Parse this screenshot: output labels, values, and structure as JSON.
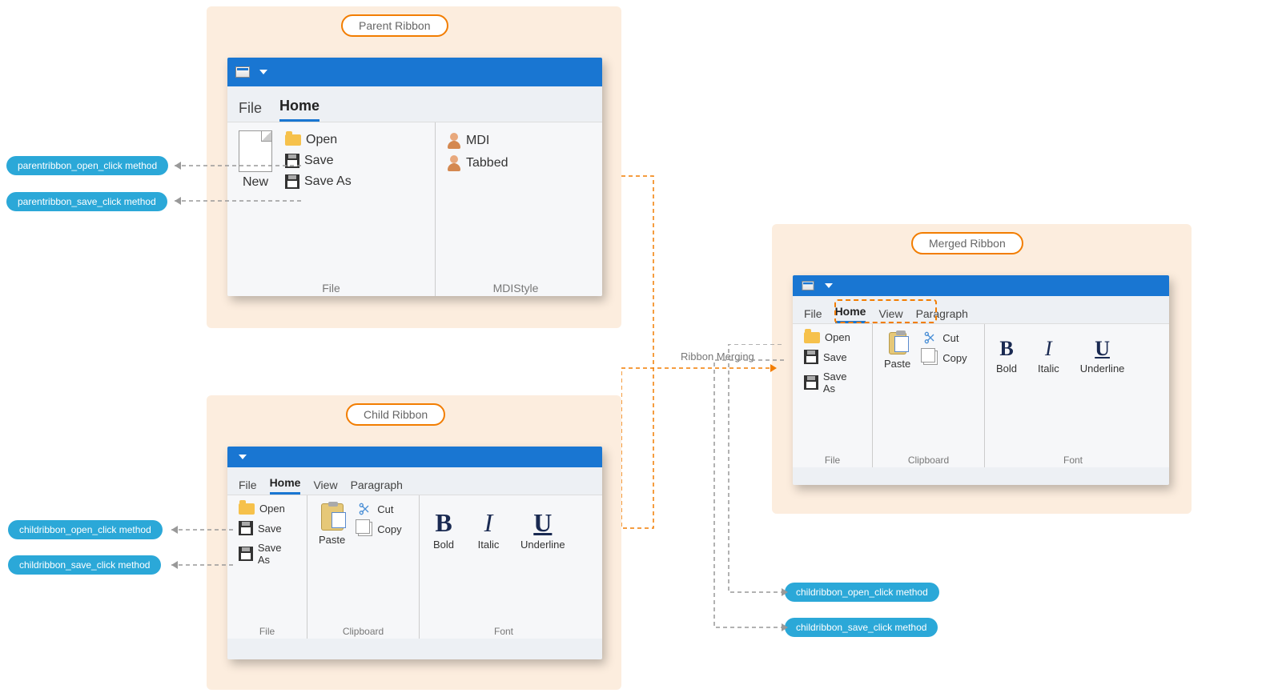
{
  "titles": {
    "parent": "Parent Ribbon",
    "child": "Child Ribbon",
    "merged": "Merged Ribbon"
  },
  "merge_label": "Ribbon Merging",
  "methods": {
    "parent_open": "parentribbon_open_click method",
    "parent_save": "parentribbon_save_click method",
    "child_open": "childribbon_open_click method",
    "child_save": "childribbon_save_click method",
    "merged_open": "childribbon_open_click method",
    "merged_save": "childribbon_save_click method"
  },
  "parent": {
    "tabs": {
      "file": "File",
      "home": "Home"
    },
    "buttons": {
      "new": "New",
      "open": "Open",
      "save": "Save",
      "saveas": "Save As",
      "mdi": "MDI",
      "tabbed": "Tabbed"
    },
    "groups": {
      "file": "File",
      "mdistyle": "MDIStyle"
    }
  },
  "child": {
    "tabs": {
      "file": "File",
      "home": "Home",
      "view": "View",
      "paragraph": "Paragraph"
    },
    "buttons": {
      "open": "Open",
      "save": "Save",
      "saveas": "Save As",
      "paste": "Paste",
      "cut": "Cut",
      "copy": "Copy",
      "bold": "Bold",
      "italic": "Italic",
      "underline": "Underline"
    },
    "groups": {
      "file": "File",
      "clipboard": "Clipboard",
      "font": "Font"
    },
    "glyphs": {
      "bold": "B",
      "italic": "I",
      "underline": "U"
    }
  },
  "merged": {
    "tabs": {
      "file": "File",
      "home": "Home",
      "view": "View",
      "paragraph": "Paragraph"
    },
    "buttons": {
      "open": "Open",
      "save": "Save",
      "saveas": "Save As",
      "paste": "Paste",
      "cut": "Cut",
      "copy": "Copy",
      "bold": "Bold",
      "italic": "Italic",
      "underline": "Underline"
    },
    "groups": {
      "file": "File",
      "clipboard": "Clipboard",
      "font": "Font"
    },
    "glyphs": {
      "bold": "B",
      "italic": "I",
      "underline": "U"
    }
  }
}
